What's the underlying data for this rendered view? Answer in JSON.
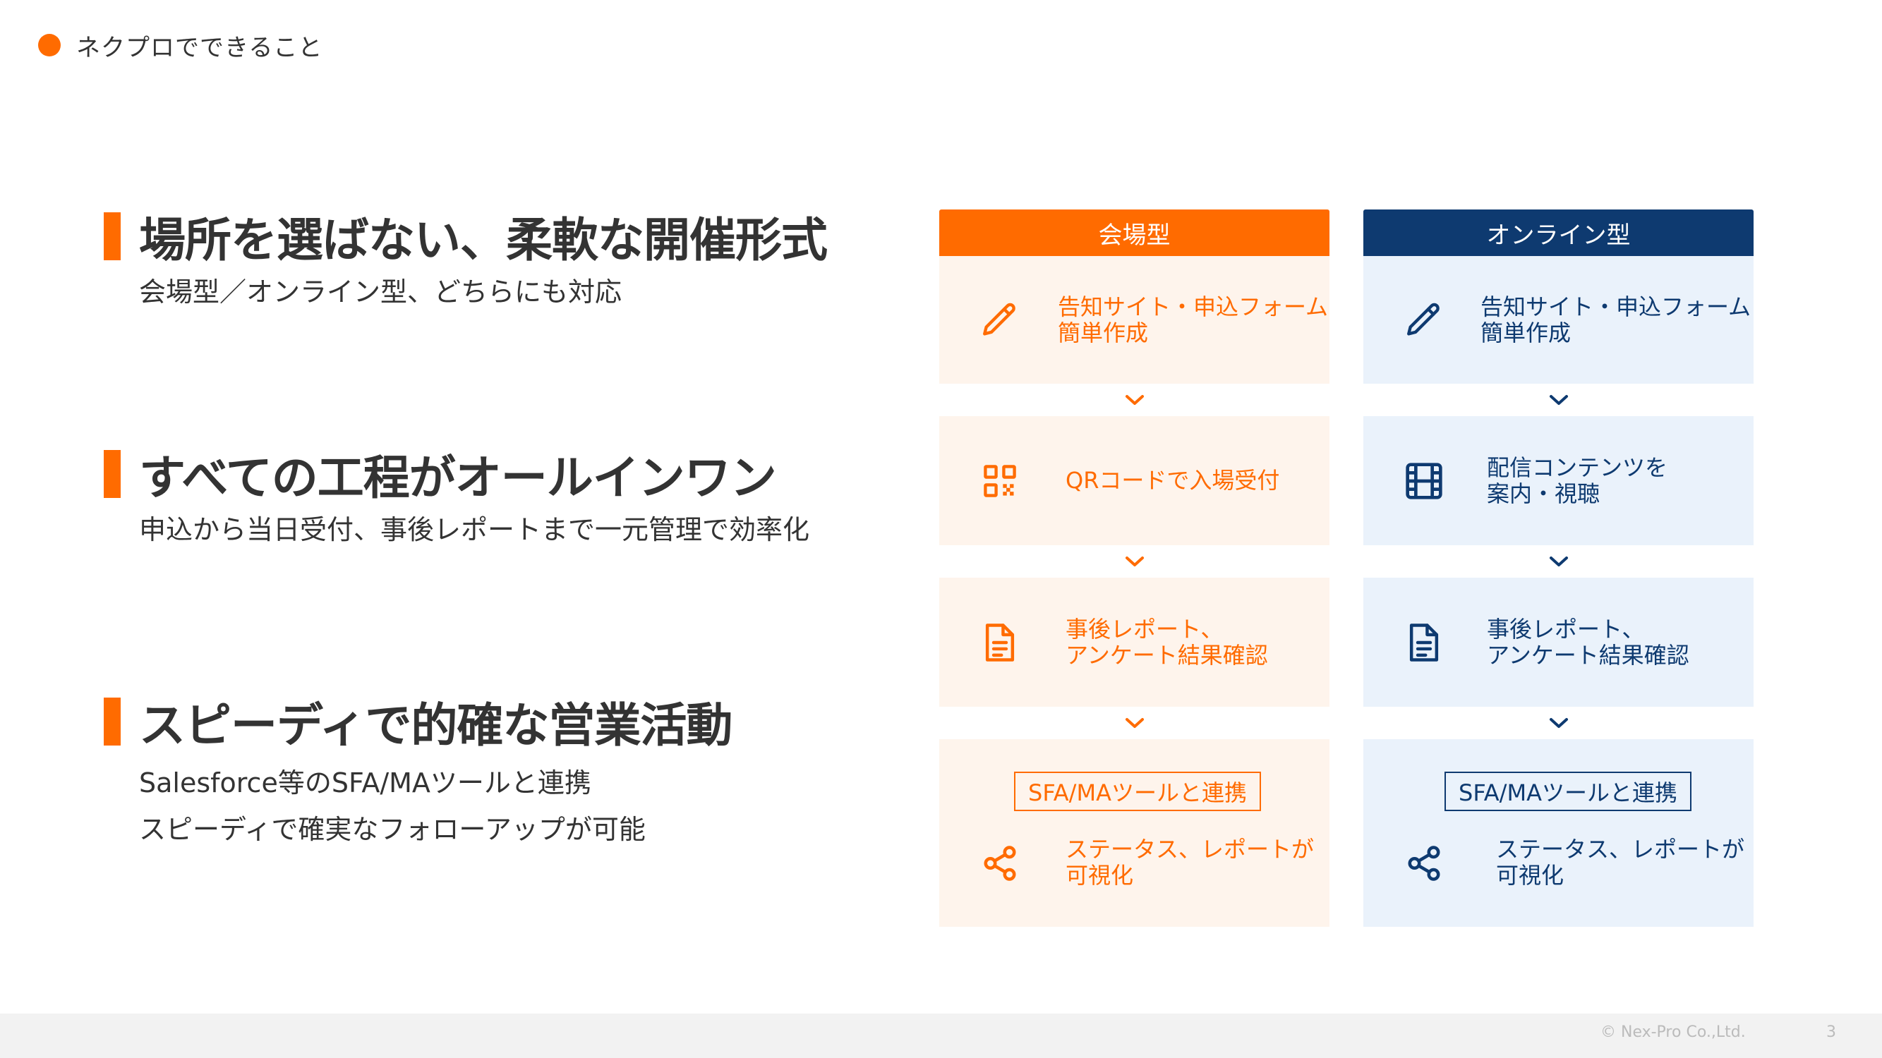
{
  "header": {
    "title": "ネクプロでできること"
  },
  "features": [
    {
      "title": "場所を選ばない、柔軟な開催形式",
      "desc_lines": [
        "会場型／オンライン型、どちらにも対応"
      ]
    },
    {
      "title": "すべての工程がオールインワン",
      "desc_lines": [
        "申込から当日受付、事後レポートまで一元管理で効率化"
      ]
    },
    {
      "title": "スピーディで的確な営業活動",
      "desc_lines": [
        "Salesforce等のSFA/MAツールと連携",
        "スピーディで確実なフォローアップが可能"
      ]
    }
  ],
  "columns": {
    "venue": {
      "header": "会場型",
      "steps": [
        {
          "icon": "pencil-icon",
          "text": "告知サイト・申込フォーム\n簡単作成"
        },
        {
          "icon": "qr-code-icon",
          "text": "QRコードで入場受付"
        },
        {
          "icon": "document-icon",
          "text": "事後レポート、\nアンケート結果確認"
        },
        {
          "icon": "share-icon",
          "tag": "SFA/MAツールと連携",
          "text": "ステータス、レポートが\n可視化"
        }
      ]
    },
    "online": {
      "header": "オンライン型",
      "steps": [
        {
          "icon": "pencil-icon",
          "text": "告知サイト・申込フォーム\n簡単作成"
        },
        {
          "icon": "film-icon",
          "text": "配信コンテンツを\n案内・視聴"
        },
        {
          "icon": "document-icon",
          "text": "事後レポート、\nアンケート結果確認"
        },
        {
          "icon": "share-icon",
          "tag": "SFA/MAツールと連携",
          "text": "ステータス、レポートが\n可視化"
        }
      ]
    }
  },
  "colors": {
    "accent_orange": "#FF6B00",
    "navy": "#0E3A70",
    "orange_bg": "#FEF4EC",
    "navy_bg": "#EAF2FB"
  },
  "footer": {
    "copyright": "© Nex-Pro Co.,Ltd.",
    "page_number": "3"
  }
}
